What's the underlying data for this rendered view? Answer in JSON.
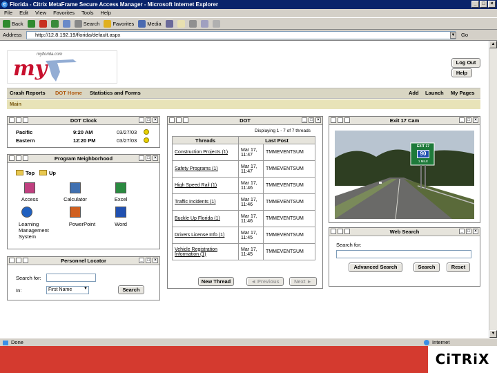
{
  "window": {
    "title": "Florida - Citrix MetaFrame Secure Access Manager - Microsoft Internet Explorer",
    "controls": [
      "_",
      "□",
      "×"
    ]
  },
  "menu": [
    "File",
    "Edit",
    "View",
    "Favorites",
    "Tools",
    "Help"
  ],
  "toolbar": {
    "back": "Back",
    "search": "Search",
    "favorites": "Favorites",
    "media": "Media"
  },
  "address": {
    "label": "Address",
    "url": "http://12.8.192.19/florida/default.aspx",
    "go": "Go"
  },
  "header": {
    "logo_text": "my",
    "logo_small": "myflorida.com",
    "logout": "Log Out",
    "help": "Help"
  },
  "nav": {
    "left": [
      "Crash Reports",
      "DOT Home",
      "Statistics and Forms"
    ],
    "active": "DOT Home",
    "right": [
      "Add",
      "Launch",
      "My Pages"
    ]
  },
  "subnav": "Main",
  "clock": {
    "title": "DOT Clock",
    "rows": [
      {
        "zone": "Pacific",
        "time": "9:20 AM",
        "date": "03/27/03"
      },
      {
        "zone": "Eastern",
        "time": "12:20 PM",
        "date": "03/27/03"
      }
    ]
  },
  "neighborhood": {
    "title": "Program Neighborhood",
    "path": [
      "Top",
      "Up"
    ],
    "apps": [
      "Access",
      "Calculator",
      "Excel",
      "Learning Management System",
      "PowerPoint",
      "Word"
    ]
  },
  "locator": {
    "title": "Personnel Locator",
    "search_label": "Search for:",
    "in_label": "In:",
    "select": "First Name",
    "button": "Search"
  },
  "dot": {
    "title": "DOT",
    "displaying": "Displaying 1 - 7 of 7 threads",
    "col_threads": "Threads",
    "col_last": "Last Post",
    "rows": [
      {
        "thread": "Construction Projects (1)",
        "date": "Mar 17, 11:47",
        "user": "TMMEVENTSUM"
      },
      {
        "thread": "Safety Programs (1)",
        "date": "Mar 17, 11:47",
        "user": "TMMEVENTSUM"
      },
      {
        "thread": "High Speed Rail (1)",
        "date": "Mar 17, 11:46",
        "user": "TMMEVENTSUM"
      },
      {
        "thread": "Traffic Incidents (1)",
        "date": "Mar 17, 11:46",
        "user": "TMMEVENTSUM"
      },
      {
        "thread": "Buckle Up Florida (1)",
        "date": "Mar 17, 11:46",
        "user": "TMMEVENTSUM"
      },
      {
        "thread": "Drivers License Info (1)",
        "date": "Mar 17, 11:45",
        "user": "TMMEVENTSUM"
      },
      {
        "thread": "Vehicle Registration Information (1)",
        "date": "Mar 17, 11:45",
        "user": "TMMEVENTSUM"
      }
    ],
    "new_thread": "New Thread",
    "previous": "◄ Previous",
    "next": "Next ►"
  },
  "cam": {
    "title": "Exit 17 Cam",
    "sign_exit": "EXIT 17",
    "sign_route": "90",
    "sign_dist": "1 MILE"
  },
  "websearch": {
    "title": "Web Search",
    "label": "Search for:",
    "advanced": "Advanced Search",
    "search": "Search",
    "reset": "Reset"
  },
  "status": {
    "left": "Done",
    "right": "Internet"
  },
  "brand": "CiTRiX"
}
